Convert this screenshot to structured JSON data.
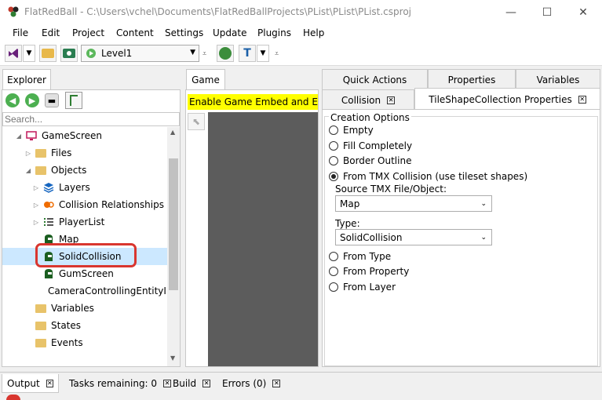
{
  "window": {
    "title": "FlatRedBall - C:\\Users\\vchel\\Documents\\FlatRedBallProjects\\PList\\PList\\PList.csproj",
    "minimize": "—",
    "maximize": "☐",
    "close": "✕"
  },
  "menu": [
    "File",
    "Edit",
    "Project",
    "Content",
    "Settings",
    "Update",
    "Plugins",
    "Help"
  ],
  "toolbar": {
    "screen_combo": "Level1"
  },
  "explorer": {
    "tab": "Explorer",
    "search_placeholder": "Search...",
    "tree": [
      {
        "label": "GameScreen",
        "icon": "screen-icon"
      },
      {
        "label": "Files",
        "icon": "folder-icon"
      },
      {
        "label": "Objects",
        "icon": "folder-icon"
      },
      {
        "label": "Layers",
        "icon": "layers-icon"
      },
      {
        "label": "Collision Relationships",
        "icon": "collision-icon"
      },
      {
        "label": "PlayerList",
        "icon": "list-icon"
      },
      {
        "label": "Map",
        "icon": "object-icon"
      },
      {
        "label": "SolidCollision",
        "icon": "object-icon"
      },
      {
        "label": "GumScreen",
        "icon": "object-icon"
      },
      {
        "label": "CameraControllingEntityIn",
        "icon": "object-icon"
      },
      {
        "label": "Variables",
        "icon": "folder-icon"
      },
      {
        "label": "States",
        "icon": "folder-icon"
      },
      {
        "label": "Events",
        "icon": "folder-icon"
      }
    ]
  },
  "game": {
    "tab": "Game",
    "banner": "Enable Game Embed and Edit in"
  },
  "right": {
    "tabs_top": [
      "Quick Actions",
      "Properties",
      "Variables"
    ],
    "tabs_second": [
      "Collision",
      "TileShapeCollection Properties"
    ],
    "group_title": "Creation Options",
    "options_top": [
      "Empty",
      "Fill Completely",
      "Border Outline",
      "From TMX Collision (use tileset shapes)"
    ],
    "source_label": "Source TMX File/Object:",
    "source_value": "Map",
    "type_label": "Type:",
    "type_value": "SolidCollision",
    "options_bottom": [
      "From Type",
      "From Property",
      "From Layer"
    ]
  },
  "bottom_tabs": [
    "Output",
    "Tasks remaining: 0",
    "Build",
    "Errors (0)"
  ],
  "colors": {
    "accent": "#0078d7",
    "highlight": "#d9362f",
    "banner": "#ffff00",
    "selection": "#cce8ff"
  }
}
